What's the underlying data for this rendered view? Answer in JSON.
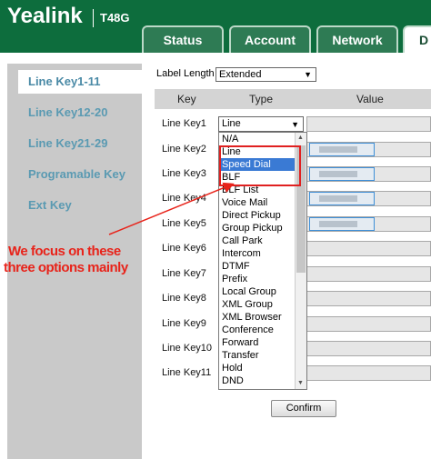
{
  "header": {
    "brand": "Yealink",
    "model": "T48G",
    "tabs": [
      "Status",
      "Account",
      "Network",
      "D"
    ]
  },
  "sidebar": {
    "items": [
      {
        "label": "Line Key1-11",
        "active": true
      },
      {
        "label": "Line Key12-20",
        "active": false
      },
      {
        "label": "Line Key21-29",
        "active": false
      },
      {
        "label": "Programable Key",
        "active": false
      },
      {
        "label": "Ext Key",
        "active": false
      }
    ]
  },
  "label_length": {
    "label": "Label Length",
    "value": "Extended"
  },
  "table": {
    "headers": {
      "key": "Key",
      "type": "Type",
      "value": "Value"
    },
    "rows": [
      "Line Key1",
      "Line Key2",
      "Line Key3",
      "Line Key4",
      "Line Key5",
      "Line Key6",
      "Line Key7",
      "Line Key8",
      "Line Key9",
      "Line Key10",
      "Line Key11"
    ],
    "row1_type": "Line"
  },
  "dropdown": {
    "options": [
      "N/A",
      "Line",
      "Speed Dial",
      "BLF",
      "BLF List",
      "Voice Mail",
      "Direct Pickup",
      "Group Pickup",
      "Call Park",
      "Intercom",
      "DTMF",
      "Prefix",
      "Local Group",
      "XML Group",
      "XML Browser",
      "Conference",
      "Forward",
      "Transfer",
      "Hold",
      "DND"
    ],
    "selected": "Speed Dial"
  },
  "annotation": {
    "line1": "We focus on these",
    "line2": "three options mainly",
    "color": "#e8231a"
  },
  "confirm_label": "Confirm"
}
